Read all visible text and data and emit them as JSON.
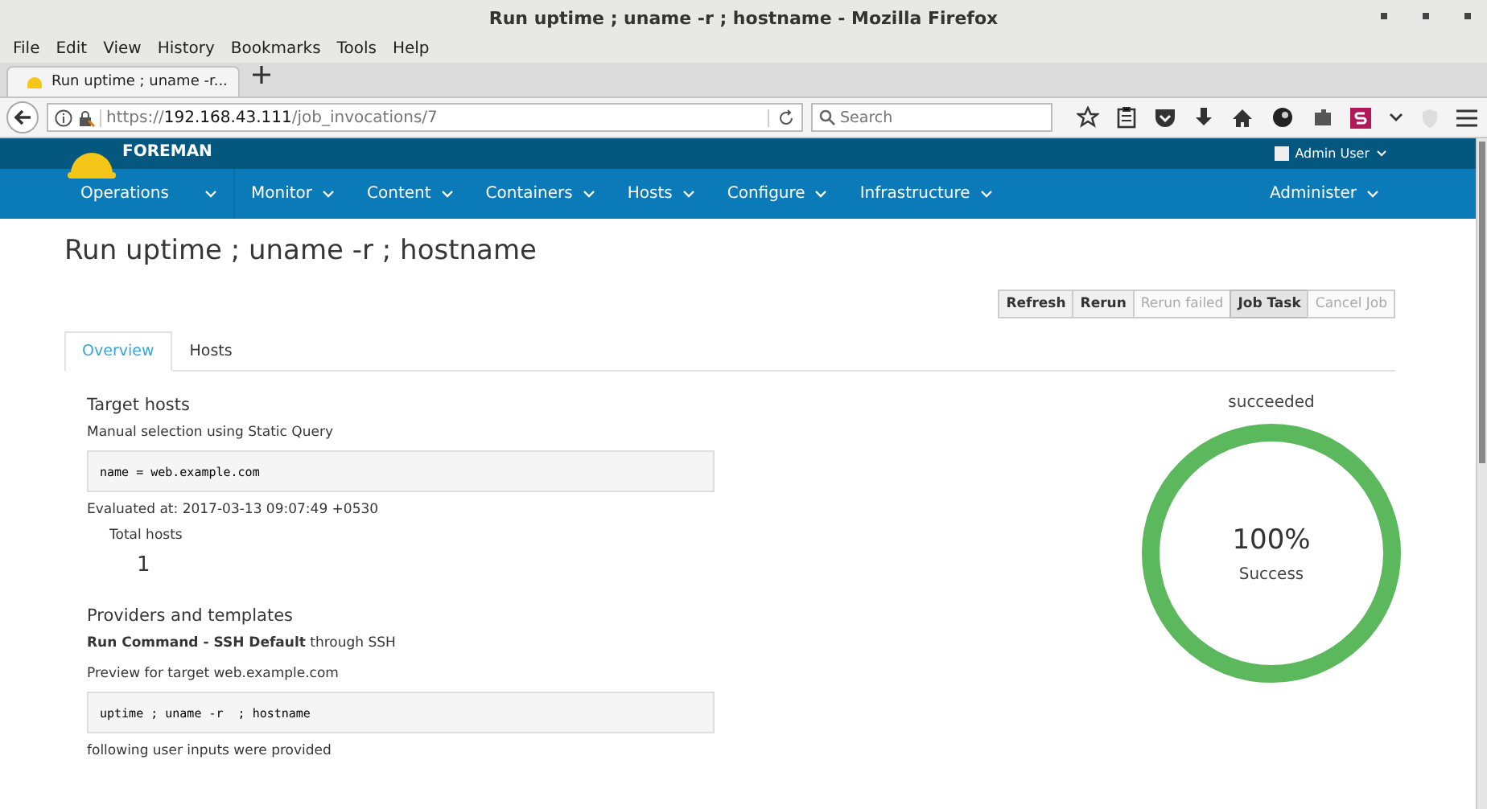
{
  "window": {
    "title": "Run uptime ; uname -r ; hostname - Mozilla Firefox"
  },
  "menubar": [
    "File",
    "Edit",
    "View",
    "History",
    "Bookmarks",
    "Tools",
    "Help"
  ],
  "browser_tab": {
    "title": "Run uptime ; uname -r..."
  },
  "address_bar": {
    "url": "https://**192.168.43.111**/job_invocations/7"
  },
  "search": {
    "placeholder": "Search"
  },
  "app": {
    "brand": "FOREMAN",
    "user": "Admin User",
    "nav": [
      {
        "label": "Operations"
      },
      {
        "label": "Monitor"
      },
      {
        "label": "Content"
      },
      {
        "label": "Containers"
      },
      {
        "label": "Hosts"
      },
      {
        "label": "Configure"
      },
      {
        "label": "Infrastructure"
      }
    ],
    "nav_right": {
      "label": "Administer"
    }
  },
  "page_title": "Run uptime ; uname -r ; hostname",
  "actions": [
    {
      "label": "Refresh",
      "disabled": false,
      "active": false
    },
    {
      "label": "Rerun",
      "disabled": false,
      "active": false
    },
    {
      "label": "Rerun failed",
      "disabled": true,
      "active": false
    },
    {
      "label": "Job Task",
      "disabled": false,
      "active": true
    },
    {
      "label": "Cancel Job",
      "disabled": true,
      "active": false
    }
  ],
  "tabs": [
    {
      "label": "Overview",
      "selected": true
    },
    {
      "label": "Hosts",
      "selected": false
    }
  ],
  "target_hosts": {
    "heading": "Target hosts",
    "selection": "Manual selection using Static Query",
    "query": "name = web.example.com",
    "evaluated": "Evaluated at: 2017-03-13 09:07:49 +0530",
    "total_label": "Total hosts",
    "total": "1"
  },
  "providers": {
    "heading": "Providers and templates",
    "template": "**Run Command - SSH Default** through SSH",
    "preview_label": "Preview for target web.example.com",
    "preview": "uptime ; uname -r  ; hostname",
    "inputs_note": "following user inputs were provided"
  },
  "status": {
    "label": "succeeded",
    "level": 1,
    "percent": "100%",
    "caption": "Success",
    "color": "#5cb85c"
  }
}
